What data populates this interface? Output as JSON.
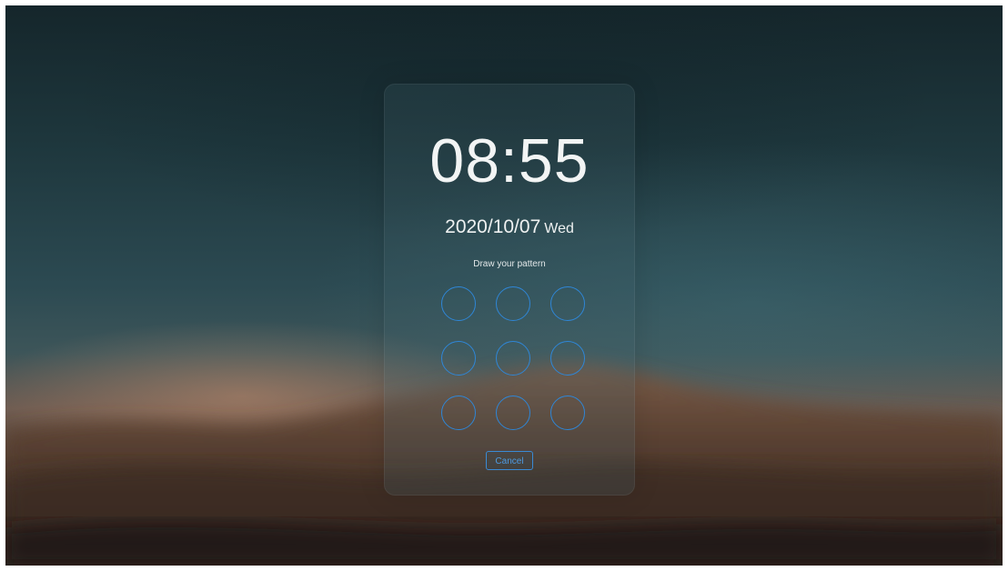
{
  "lock_screen": {
    "time": "08:55",
    "date": "2020/10/07",
    "weekday": "Wed",
    "prompt": "Draw your pattern",
    "pattern_dots": 9,
    "cancel_label": "Cancel"
  },
  "colors": {
    "accent": "#2f86d6",
    "text": "#f2f4f4"
  }
}
